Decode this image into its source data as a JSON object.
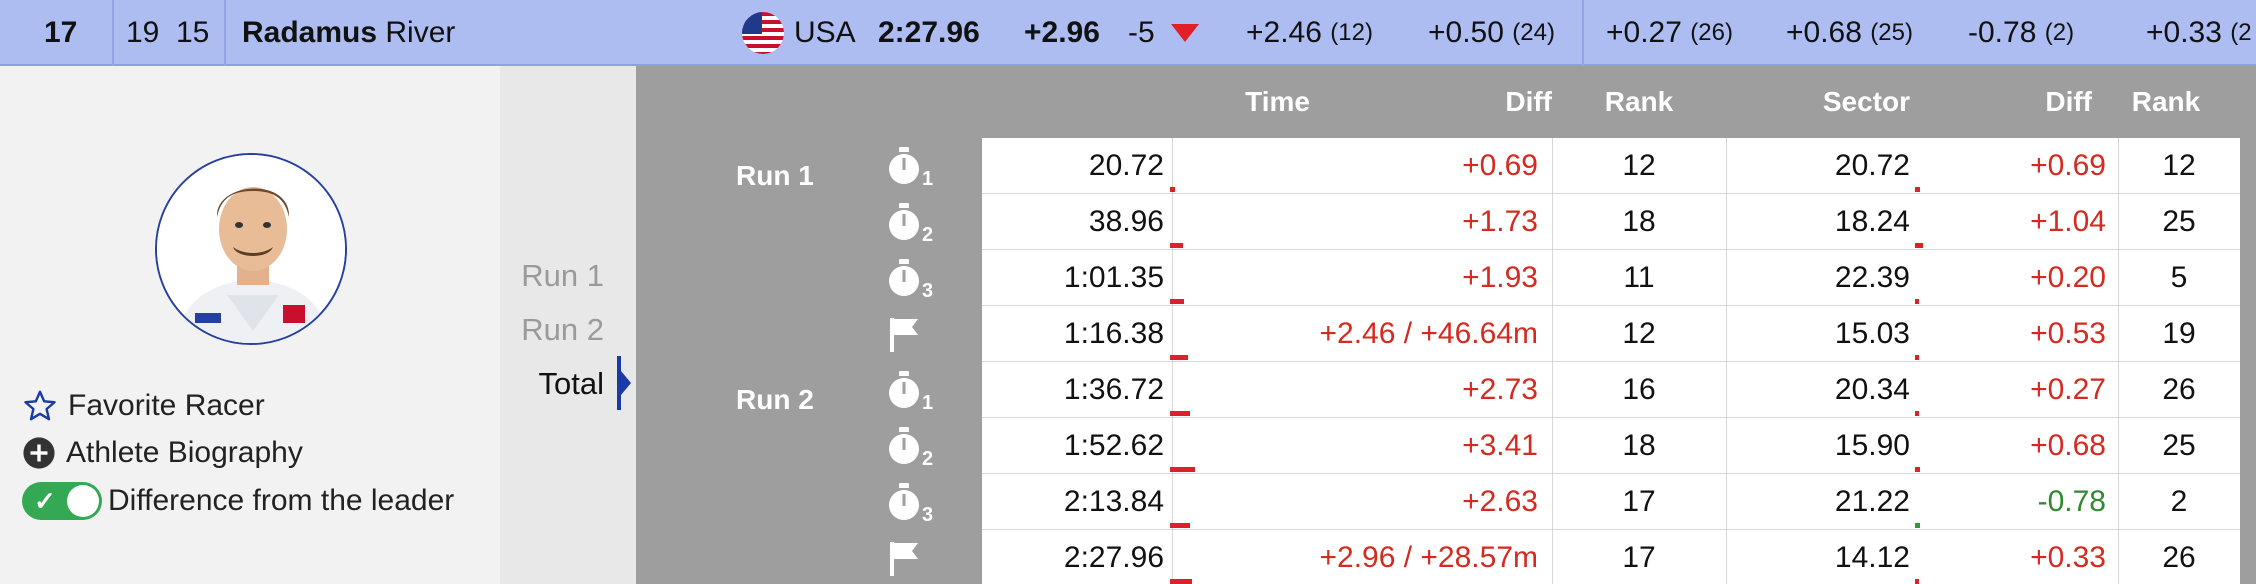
{
  "header": {
    "rank": "17",
    "bib": "19",
    "start_no": "15",
    "last_name": "Radamus",
    "first_name": "River",
    "country": "USA",
    "time": "2:27.96",
    "diff": "+2.96",
    "change": "-5",
    "splits": [
      {
        "diff": "+2.46",
        "rank": "(12)"
      },
      {
        "diff": "+0.50",
        "rank": "(24)"
      },
      {
        "diff": "+0.27",
        "rank": "(26)"
      },
      {
        "diff": "+0.68",
        "rank": "(25)"
      },
      {
        "diff": "-0.78",
        "rank": "(2)"
      },
      {
        "diff": "+0.33",
        "rank": "(2"
      }
    ]
  },
  "left": {
    "favorite_label": "Favorite Racer",
    "bio_label": "Athlete Biography",
    "diff_toggle_label": "Difference from the leader",
    "toggle_on": true
  },
  "runs_nav": [
    "Run 1",
    "Run 2",
    "Total"
  ],
  "table": {
    "headers": {
      "time": "Time",
      "diff": "Diff",
      "rank": "Rank",
      "sector": "Sector",
      "sdiff": "Diff",
      "srank": "Rank"
    },
    "run_labels": [
      "Run 1",
      "Run 2"
    ],
    "rows": [
      {
        "icon": "stopwatch-icon",
        "sub": "1",
        "time": "20.72",
        "diff": "+0.69",
        "rank": "12",
        "sector": "20.72",
        "sdiff": "+0.69",
        "srank": "12",
        "bar": 0.15,
        "sbar": 0.15,
        "sgreen": false
      },
      {
        "icon": "stopwatch-icon",
        "sub": "2",
        "time": "38.96",
        "diff": "+1.73",
        "rank": "18",
        "sector": "18.24",
        "sdiff": "+1.04",
        "srank": "25",
        "bar": 0.35,
        "sbar": 0.22,
        "sgreen": false
      },
      {
        "icon": "stopwatch-icon",
        "sub": "3",
        "time": "1:01.35",
        "diff": "+1.93",
        "rank": "11",
        "sector": "22.39",
        "sdiff": "+0.20",
        "srank": "5",
        "bar": 0.4,
        "sbar": 0.05,
        "sgreen": false
      },
      {
        "icon": "finish-flag-icon",
        "sub": "",
        "time": "1:16.38",
        "diff": "+2.46 / +46.64m",
        "rank": "12",
        "sector": "15.03",
        "sdiff": "+0.53",
        "srank": "19",
        "bar": 0.5,
        "sbar": 0.12,
        "sgreen": false
      },
      {
        "icon": "stopwatch-icon",
        "sub": "1",
        "time": "1:36.72",
        "diff": "+2.73",
        "rank": "16",
        "sector": "20.34",
        "sdiff": "+0.27",
        "srank": "26",
        "bar": 0.56,
        "sbar": 0.06,
        "sgreen": false
      },
      {
        "icon": "stopwatch-icon",
        "sub": "2",
        "time": "1:52.62",
        "diff": "+3.41",
        "rank": "18",
        "sector": "15.90",
        "sdiff": "+0.68",
        "srank": "25",
        "bar": 0.7,
        "sbar": 0.15,
        "sgreen": false
      },
      {
        "icon": "stopwatch-icon",
        "sub": "3",
        "time": "2:13.84",
        "diff": "+2.63",
        "rank": "17",
        "sector": "21.22",
        "sdiff": "-0.78",
        "srank": "2",
        "bar": 0.55,
        "sbar": 0.15,
        "sgreen": true
      },
      {
        "icon": "finish-flag-icon",
        "sub": "",
        "time": "2:27.96",
        "diff": "+2.96 / +28.57m",
        "rank": "17",
        "sector": "14.12",
        "sdiff": "+0.33",
        "srank": "26",
        "bar": 0.6,
        "sbar": 0.08,
        "sgreen": false
      }
    ]
  },
  "colors": {
    "top_bg": "#aebdf1",
    "accent": "#1a3aa5",
    "diff_red": "#d42a20",
    "diff_green": "#2f8a2f",
    "toggle_green": "#34a853"
  }
}
